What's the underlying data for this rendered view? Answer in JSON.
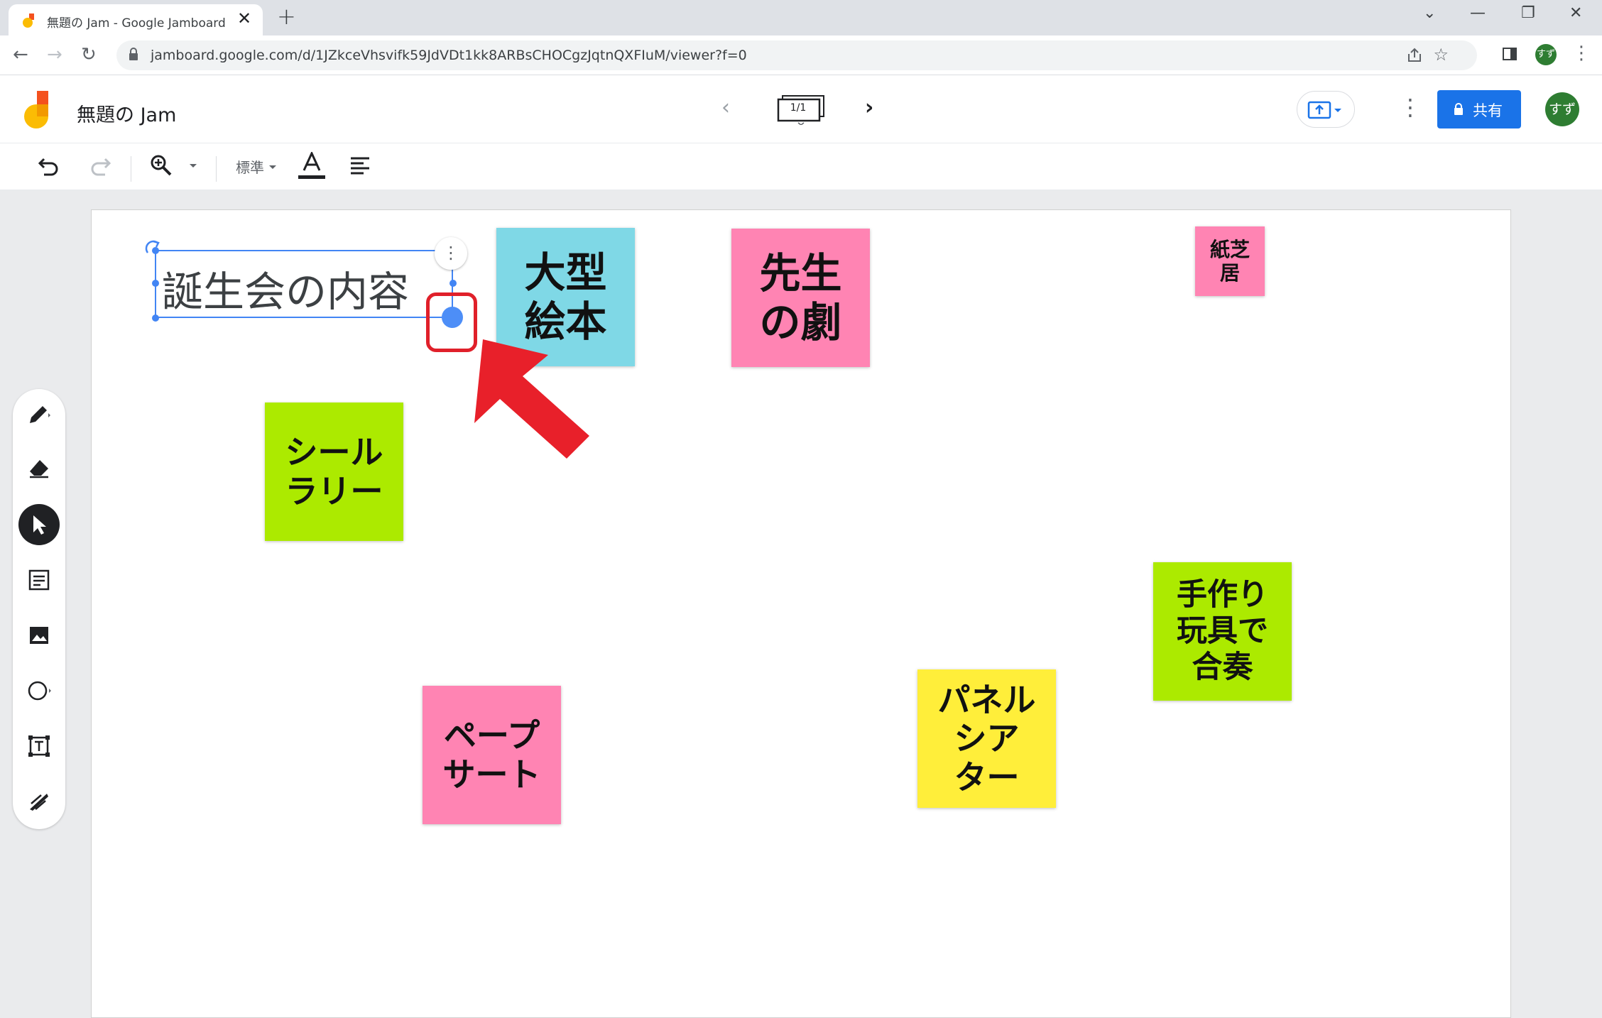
{
  "browser": {
    "tab_title": "無題の Jam - Google Jamboard",
    "url": "jamboard.google.com/d/1JZkceVhsvifk59JdVDt1kk8ARBsCHOCgzJqtnQXFIuM/viewer?f=0",
    "profile_initials": "すず"
  },
  "app": {
    "jam_title": "無題の Jam",
    "frame_counter": "1/1",
    "share_label": "共有",
    "avatar_initials": "すず"
  },
  "toolbar": {
    "font_size": "標準"
  },
  "textbox": {
    "text": "誕生会の内容"
  },
  "notes": [
    {
      "text": "大型\n絵本",
      "color": "#7fd8e6"
    },
    {
      "text": "先生\nの劇",
      "color": "#ff84b3"
    },
    {
      "text": "紙芝\n居",
      "color": "#ff84b3"
    },
    {
      "text": "シール\nラリー",
      "color": "#acea00"
    },
    {
      "text": "手作り\n玩具で\n合奏",
      "color": "#acea00"
    },
    {
      "text": "パネル\nシア\nター",
      "color": "#ffee3a"
    },
    {
      "text": "ペープ\nサート",
      "color": "#ff84b3"
    }
  ],
  "colors": {
    "accent": "#1a73e8",
    "selection": "#4285f4",
    "highlight": "#e0202a"
  }
}
